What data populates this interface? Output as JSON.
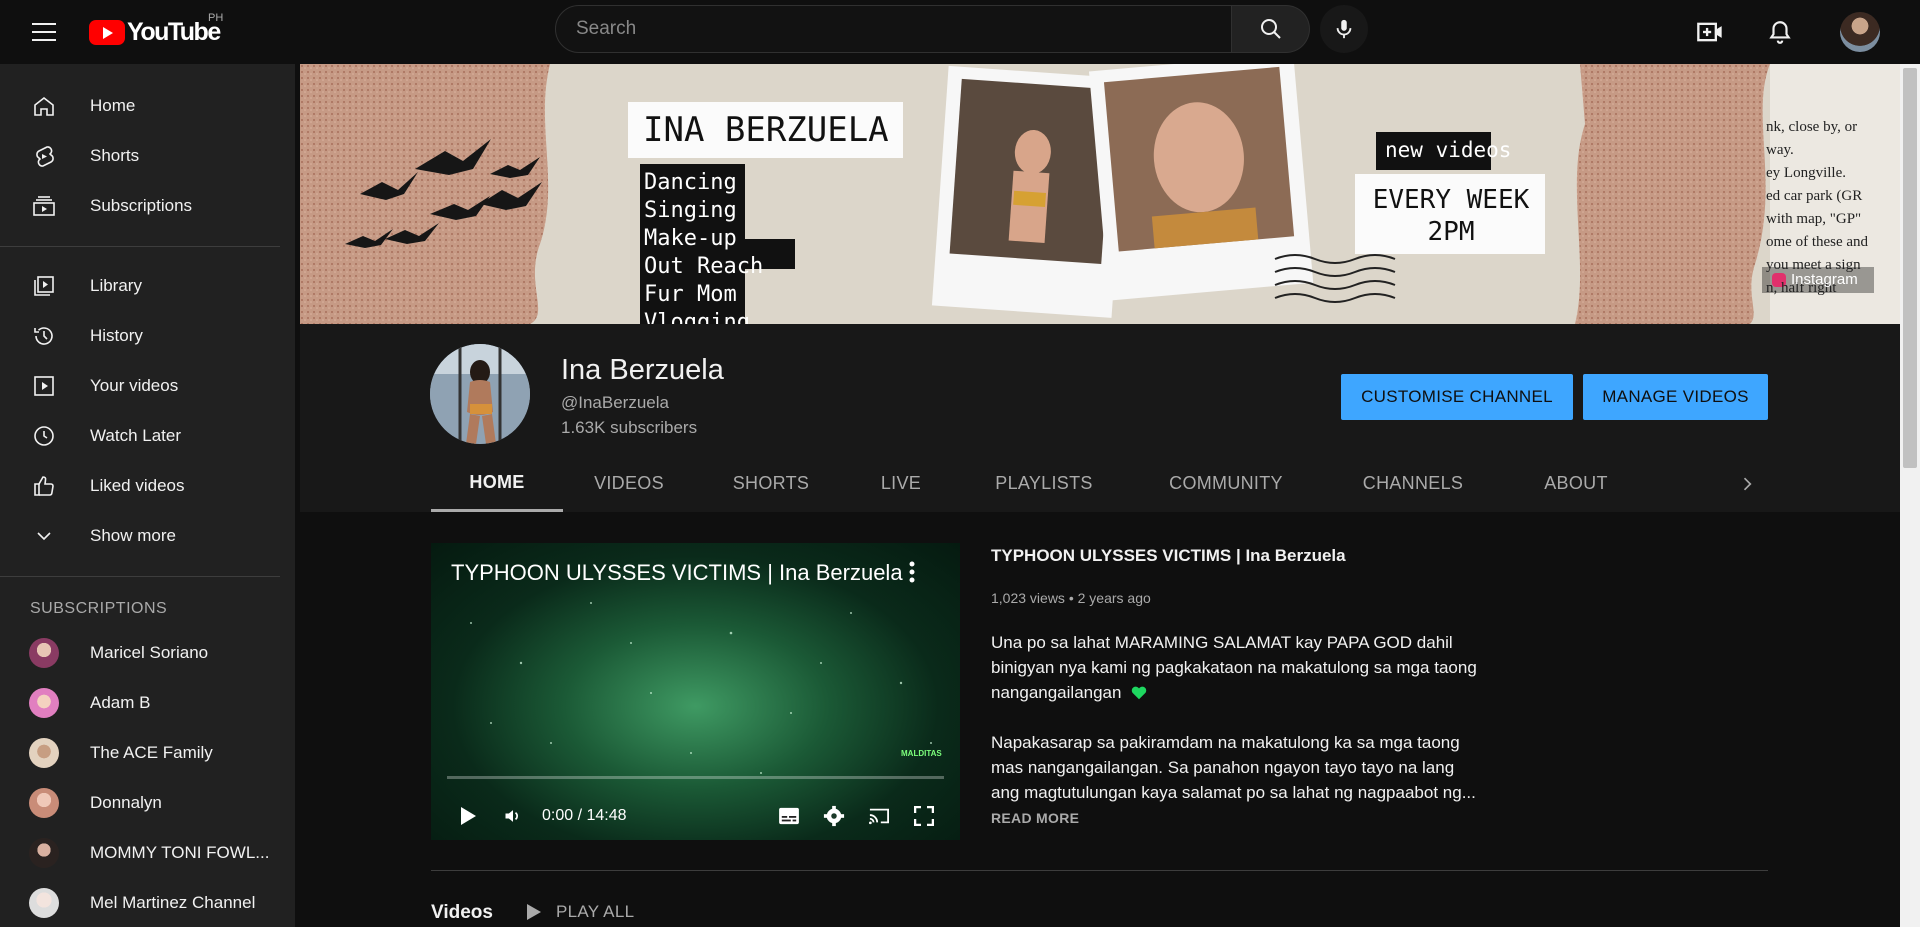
{
  "topbar": {
    "logo_text": "YouTube",
    "region": "PH",
    "search_placeholder": "Search"
  },
  "sidebar": {
    "main_items": [
      {
        "label": "Home",
        "icon": "home-icon"
      },
      {
        "label": "Shorts",
        "icon": "shorts-icon"
      },
      {
        "label": "Subscriptions",
        "icon": "subscriptions-icon"
      }
    ],
    "library_items": [
      {
        "label": "Library",
        "icon": "library-icon"
      },
      {
        "label": "History",
        "icon": "history-icon"
      },
      {
        "label": "Your videos",
        "icon": "your-videos-icon"
      },
      {
        "label": "Watch Later",
        "icon": "watch-later-icon"
      },
      {
        "label": "Liked videos",
        "icon": "liked-videos-icon"
      },
      {
        "label": "Show more",
        "icon": "chevron-down-icon"
      }
    ],
    "subscriptions_heading": "SUBSCRIPTIONS",
    "subscriptions": [
      {
        "label": "Maricel Soriano",
        "color": "#c98fa0"
      },
      {
        "label": "Adam B",
        "color": "#e6a0c4"
      },
      {
        "label": "The ACE Family",
        "color": "#d8c1a6"
      },
      {
        "label": "Donnalyn",
        "color": "#e3b9a6"
      },
      {
        "label": "MOMMY TONI FOWL...",
        "color": "#4a3f3a"
      },
      {
        "label": "Mel Martinez Channel",
        "color": "#e8e0dc"
      }
    ]
  },
  "banner": {
    "name": "INA BERZUELA",
    "topics": [
      "Dancing",
      "Singing",
      "Make-up",
      "Out Reach",
      "Fur Mom",
      "Vlogging"
    ],
    "new_videos": "new videos",
    "schedule_line1": "EVERY WEEK",
    "schedule_line2": "2PM",
    "instagram_label": "Instagram",
    "newspaper_text": [
      "nk, close by, or",
      "way.",
      "ey Longville.",
      "ed car park (GR",
      "with map, \"GP\"",
      "ome of these and",
      "you meet a sign",
      "n, half right"
    ]
  },
  "channel": {
    "name": "Ina Berzuela",
    "handle": "@InaBerzuela",
    "subscribers": "1.63K subscribers",
    "customise_button": "CUSTOMISE CHANNEL",
    "manage_button": "MANAGE VIDEOS"
  },
  "tabs": [
    "HOME",
    "VIDEOS",
    "SHORTS",
    "LIVE",
    "PLAYLISTS",
    "COMMUNITY",
    "CHANNELS",
    "ABOUT"
  ],
  "featured": {
    "overlay_title": "TYPHOON ULYSSES VICTIMS | Ina Berzuela",
    "watermark": "MALDITAS",
    "time": "0:00 / 14:48",
    "progress": 0,
    "title": "TYPHOON ULYSSES VICTIMS | Ina Berzuela",
    "meta": "1,023 views • 2 years ago",
    "desc_line1": "Una po sa lahat MARAMING SALAMAT kay PAPA GOD dahil",
    "desc_line2": "binigyan nya kami ng pagkakataon na makatulong sa mga taong",
    "desc_line3": "nangangailangan",
    "desc_line4": "Napakasarap sa pakiramdam na makatulong ka sa mga taong",
    "desc_line5": "mas nangangailangan. Sa panahon ngayon tayo tayo na lang",
    "desc_line6": "ang magtutulungan kaya salamat po sa lahat ng nagpaabot ng...",
    "read_more": "READ MORE"
  },
  "videos_section": {
    "title": "Videos",
    "play_all": "PLAY ALL"
  },
  "colors": {
    "accent": "#3ea6ff",
    "background": "#0f0f0f",
    "sidebar": "#212121",
    "header": "#181818",
    "logo_red": "#ff0000"
  }
}
